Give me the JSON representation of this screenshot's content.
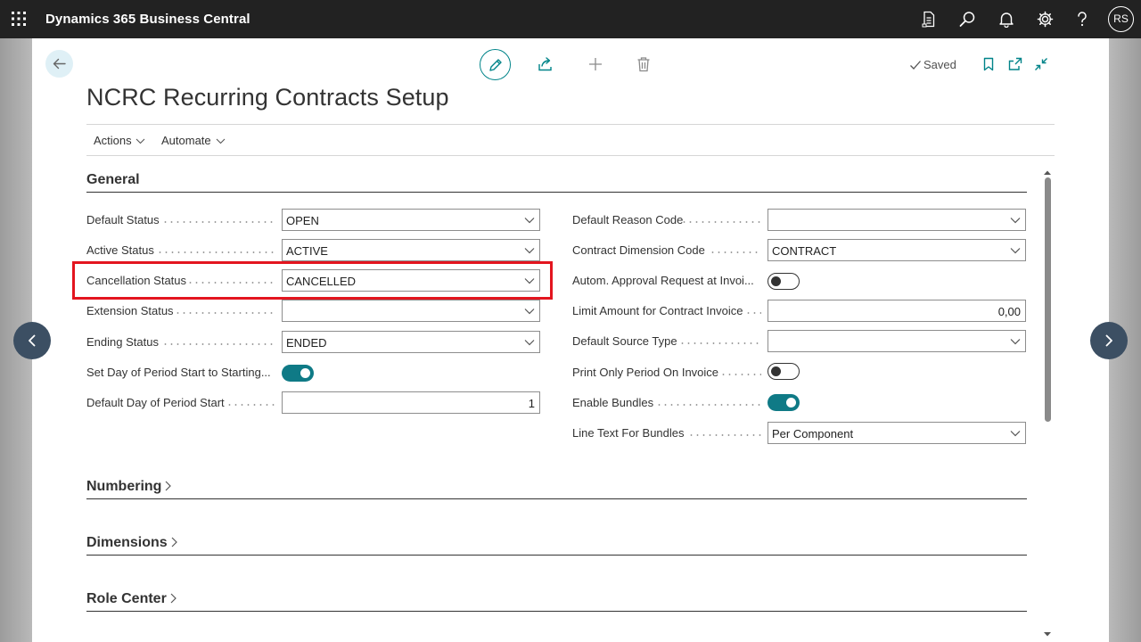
{
  "app": {
    "title": "Dynamics 365 Business Central",
    "user_initials": "RS"
  },
  "top_icons": [
    "document-icon",
    "search-icon",
    "bell-icon",
    "gear-icon",
    "help-icon"
  ],
  "status": {
    "saved": "Saved"
  },
  "page": {
    "title": "NCRC Recurring Contracts Setup"
  },
  "menus": {
    "actions": "Actions",
    "automate": "Automate"
  },
  "sections": {
    "general": "General",
    "numbering": "Numbering",
    "dimensions": "Dimensions",
    "role_center": "Role Center"
  },
  "left_fields": [
    {
      "label": "Default Status",
      "type": "dropdown",
      "value": "OPEN"
    },
    {
      "label": "Active Status",
      "type": "dropdown",
      "value": "ACTIVE"
    },
    {
      "label": "Cancellation Status",
      "type": "dropdown",
      "value": "CANCELLED"
    },
    {
      "label": "Extension Status",
      "type": "dropdown",
      "value": ""
    },
    {
      "label": "Ending Status",
      "type": "dropdown",
      "value": "ENDED"
    },
    {
      "label": "Set Day of Period Start to Starting...",
      "type": "toggle",
      "value": "on"
    },
    {
      "label": "Default Day of Period Start",
      "type": "number",
      "value": "1"
    }
  ],
  "right_fields": [
    {
      "label": "Default Reason Code",
      "type": "dropdown",
      "value": ""
    },
    {
      "label": "Contract Dimension Code",
      "type": "dropdown",
      "value": "CONTRACT"
    },
    {
      "label": "Autom. Approval Request at Invoi...",
      "type": "toggle",
      "value": "off"
    },
    {
      "label": "Limit Amount for Contract Invoice",
      "type": "number",
      "value": "0,00"
    },
    {
      "label": "Default Source Type",
      "type": "dropdown",
      "value": ""
    },
    {
      "label": "Print Only Period On Invoice",
      "type": "toggle",
      "value": "off"
    },
    {
      "label": "Enable Bundles",
      "type": "toggle",
      "value": "on"
    },
    {
      "label": "Line Text For Bundles",
      "type": "dropdown",
      "value": "Per Component"
    }
  ],
  "colors": {
    "accent": "#008489",
    "toggle_on": "#0f7a86",
    "highlight": "#e3151f",
    "topbar": "#222222"
  }
}
